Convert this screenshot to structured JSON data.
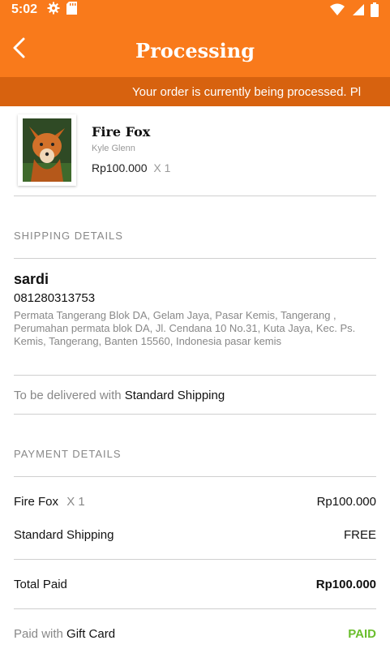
{
  "status_bar": {
    "time": "5:02"
  },
  "header": {
    "title": "Processing"
  },
  "banner": {
    "text": "Your order is currently being processed. Pl"
  },
  "product": {
    "name": "Fire Fox",
    "artist": "Kyle Glenn",
    "price": "Rp100.000",
    "qty": "X 1"
  },
  "shipping": {
    "section_label": "SHIPPING DETAILS",
    "name": "sardi",
    "phone": "081280313753",
    "address": "Permata Tangerang Blok DA, Gelam Jaya, Pasar Kemis, Tangerang , Perumahan permata blok DA, Jl. Cendana 10 No.31, Kuta Jaya, Kec. Ps. Kemis, Tangerang, Banten 15560, Indonesia pasar kemis",
    "delivery_prefix": "To be delivered with",
    "delivery_method": "Standard Shipping"
  },
  "payment": {
    "section_label": "PAYMENT DETAILS",
    "item_name": "Fire Fox",
    "item_qty": "X 1",
    "item_price": "Rp100.000",
    "shipping_label": "Standard Shipping",
    "shipping_value": "FREE",
    "total_label": "Total Paid",
    "total_value": "Rp100.000",
    "paid_prefix": "Paid with",
    "paid_method": "Gift Card",
    "paid_status": "PAID"
  },
  "colors": {
    "primary": "#F97A1B",
    "banner": "#D7620F",
    "paid": "#6BBE2E"
  }
}
